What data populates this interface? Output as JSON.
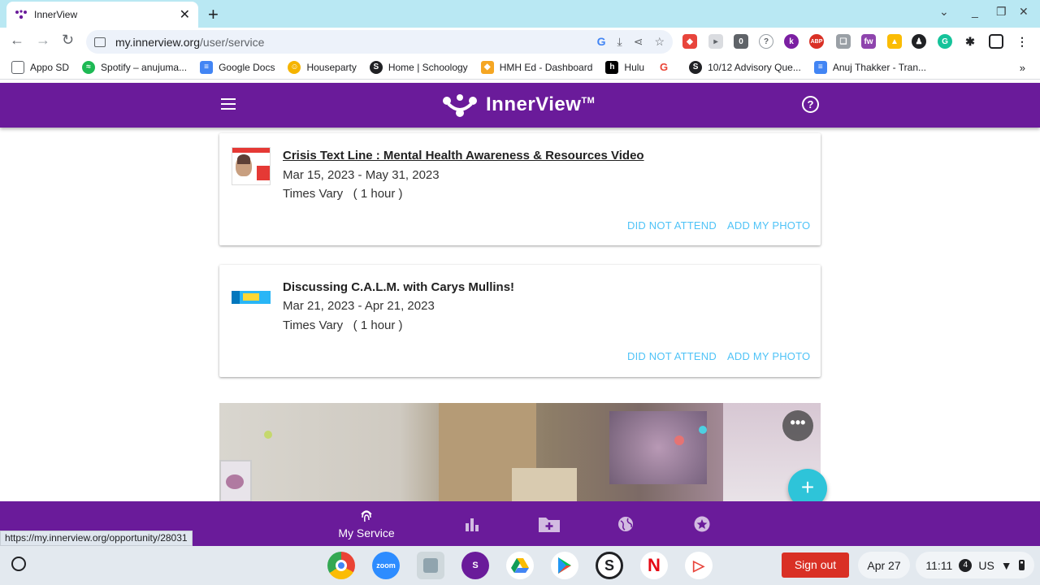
{
  "browser": {
    "tab_title": "InnerView",
    "url_domain": "my.innerview.org",
    "url_path": "/user/service",
    "status_url": "https://my.innerview.org/opportunity/28031"
  },
  "bookmarks": [
    {
      "label": "Appo SD",
      "icon": "folder-icon",
      "color": "#5f6368"
    },
    {
      "label": "Spotify – anujuma...",
      "icon": "spotify-icon",
      "color": "#1db954"
    },
    {
      "label": "Google Docs",
      "icon": "docs-icon",
      "color": "#4285f4"
    },
    {
      "label": "Houseparty",
      "icon": "houseparty-icon",
      "color": "#f5b400"
    },
    {
      "label": "Home | Schoology",
      "icon": "schoology-icon",
      "color": "#202124"
    },
    {
      "label": "HMH Ed - Dashboard",
      "icon": "hmh-icon",
      "color": "#f5a623"
    },
    {
      "label": "Hulu",
      "icon": "hulu-icon",
      "color": "#000000"
    },
    {
      "label": "",
      "icon": "google-icon",
      "color": "#ea4335"
    },
    {
      "label": "10/12 Advisory Que...",
      "icon": "schoology-icon",
      "color": "#202124"
    },
    {
      "label": "Anuj Thakker - Tran...",
      "icon": "docs-icon",
      "color": "#4285f4"
    }
  ],
  "bookmarks_more": "»",
  "app": {
    "brand_name": "InnerView",
    "brand_tm": "TM",
    "accent": "#6a1b9a",
    "action_color": "#4fc3f7"
  },
  "cards": [
    {
      "title": "Crisis Text Line : Mental Health Awareness & Resources Video",
      "dates": "Mar 15, 2023 - May 31, 2023",
      "times": "Times Vary   ( 1 hour )",
      "action_1": "DID NOT ATTEND",
      "action_2": "ADD MY PHOTO"
    },
    {
      "title": "Discussing C.A.L.M. with Carys Mullins!",
      "dates": "Mar 21, 2023 - Apr 21, 2023",
      "times": "Times Vary   ( 1 hour )",
      "action_1": "DID NOT ATTEND",
      "action_2": "ADD MY PHOTO"
    }
  ],
  "fab_label": "+",
  "more_label": "•••",
  "bottom_nav": {
    "active_label": "My Service",
    "items": [
      "fingerprint-icon",
      "bar-chart-icon",
      "folder-add-icon",
      "globe-icon",
      "star-icon"
    ]
  },
  "shelf": {
    "sign_out": "Sign out",
    "date": "Apr 27",
    "time": "11:11",
    "notif_count": "4",
    "locale": "US",
    "zoom_label": "zoom"
  }
}
